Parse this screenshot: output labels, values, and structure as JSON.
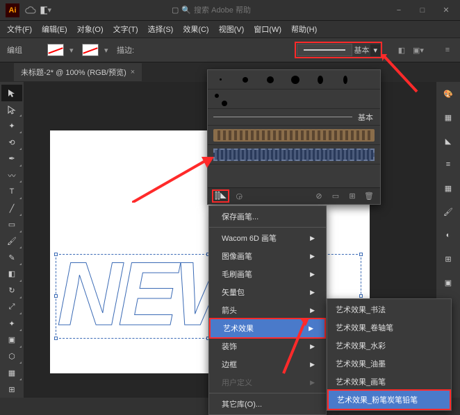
{
  "titlebar": {
    "search_placeholder": "搜索 Adobe 帮助"
  },
  "menu": [
    "文件(F)",
    "编辑(E)",
    "对象(O)",
    "文字(T)",
    "选择(S)",
    "效果(C)",
    "视图(V)",
    "窗口(W)",
    "帮助(H)"
  ],
  "control": {
    "group_label": "编组",
    "stroke_label": "描边:",
    "basic_label": "基本"
  },
  "tab": {
    "title": "未标题-2* @ 100% (RGB/预览)"
  },
  "canvas": {
    "text": "NEW"
  },
  "brush_panel": {
    "basic": "基本"
  },
  "context": {
    "save": "保存画笔...",
    "wacom": "Wacom 6D 画笔",
    "image": "图像画笔",
    "bristle": "毛刷画笔",
    "vector": "矢量包",
    "arrows": "箭头",
    "artistic": "艺术效果",
    "decorative": "装饰",
    "borders": "边框",
    "userdef": "用户定义",
    "other": "其它库(O)..."
  },
  "submenu": {
    "calligraphy": "艺术效果_书法",
    "scroll": "艺术效果_卷轴笔",
    "watercolor": "艺术效果_水彩",
    "ink": "艺术效果_油墨",
    "paintbrush": "艺术效果_画笔",
    "chalk": "艺术效果_粉笔炭笔铅笔"
  }
}
